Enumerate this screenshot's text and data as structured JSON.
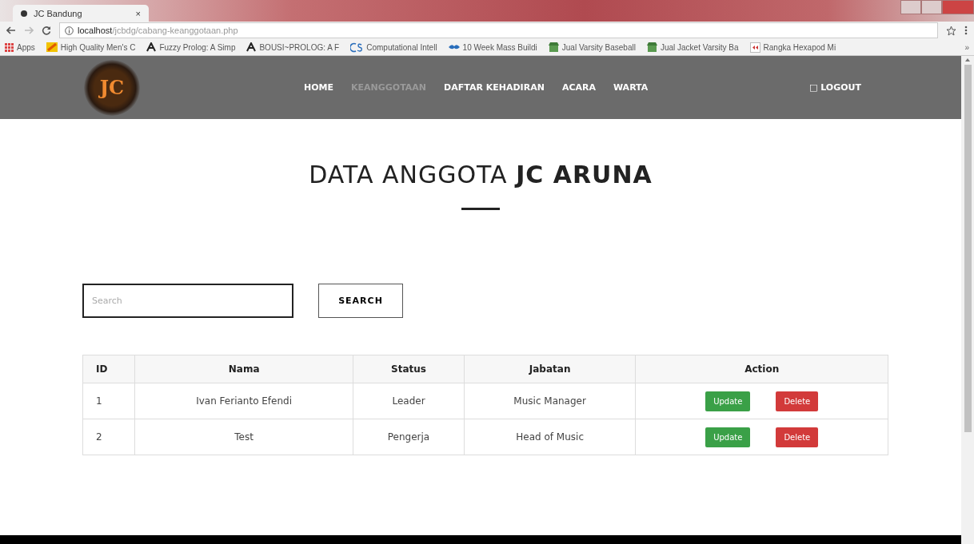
{
  "browser": {
    "tab_title": "JC Bandung",
    "tab_close": "×",
    "address": {
      "host": "localhost",
      "path": "/jcbdg/cabang-keanggotaan.php"
    },
    "bookmarks": [
      {
        "label": "Apps",
        "kind": "apps"
      },
      {
        "label": "High Quality Men's C",
        "kind": "flag"
      },
      {
        "label": "Fuzzy Prolog: A Simp",
        "kind": "letter"
      },
      {
        "label": "BOUSI~PROLOG: A F",
        "kind": "letter"
      },
      {
        "label": "Computational Intell",
        "kind": "cs"
      },
      {
        "label": "10 Week Mass Buildi",
        "kind": "bird"
      },
      {
        "label": "Jual Varsity Baseball",
        "kind": "shop"
      },
      {
        "label": "Jual Jacket Varsity Ba",
        "kind": "shop"
      },
      {
        "label": "Rangka Hexapod Mi",
        "kind": "doc"
      }
    ],
    "more": "»"
  },
  "nav": {
    "logo": "JC",
    "items": [
      {
        "label": "HOME",
        "selected": false
      },
      {
        "label": "KEANGGOTAAN",
        "selected": true
      },
      {
        "label": "DAFTAR KEHADIRAN",
        "selected": false
      },
      {
        "label": "ACARA",
        "selected": false
      },
      {
        "label": "WARTA",
        "selected": false
      }
    ],
    "logout": "□ LOGOUT"
  },
  "heading": "DATA ANGGOTA **JC ARUNA**",
  "search": {
    "placeholder": "Search",
    "button": "SEARCH"
  },
  "table": {
    "columns": [
      "ID",
      "Nama",
      "Status",
      "Jabatan",
      "Action"
    ],
    "rows": [
      {
        "cells": [
          "1",
          "Ivan Ferianto Efendi",
          "Leader",
          "Music Manager"
        ],
        "actions": [
          {
            "label": "Update",
            "kind": "update"
          },
          {
            "label": "Delete",
            "kind": "delete"
          }
        ]
      },
      {
        "cells": [
          "2",
          "Test",
          "Pengerja",
          "Head of Music"
        ],
        "actions": [
          {
            "label": "Update",
            "kind": "update"
          },
          {
            "label": "Delete",
            "kind": "delete"
          }
        ]
      }
    ]
  }
}
